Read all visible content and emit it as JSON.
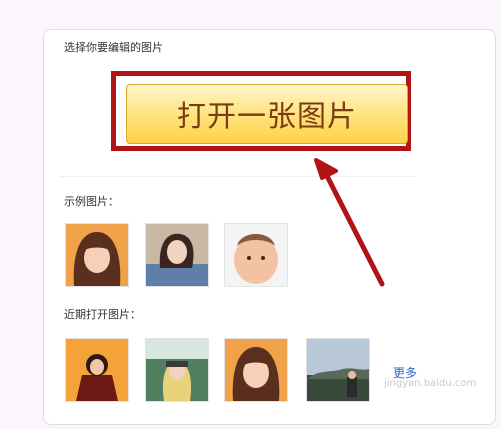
{
  "header": {
    "select_label": "选择你要编辑的图片"
  },
  "open_button": {
    "label": "打开一张图片"
  },
  "samples": {
    "title": "示例图片：",
    "items": [
      {
        "name": "sample-photo-1",
        "alt": ""
      },
      {
        "name": "sample-photo-2",
        "alt": ""
      },
      {
        "name": "sample-photo-3",
        "alt": ""
      }
    ]
  },
  "recent": {
    "title": "近期打开图片：",
    "more_label": "更多",
    "items": [
      {
        "name": "recent-photo-1"
      },
      {
        "name": "recent-photo-2"
      },
      {
        "name": "recent-photo-3"
      },
      {
        "name": "recent-photo-4"
      }
    ]
  },
  "watermark": {
    "text": "jingyan.baidu.com"
  },
  "colors": {
    "highlight_border": "#b11414",
    "button_text": "#7a3c10",
    "button_fill": "#ffe27a",
    "link": "#2f69c8"
  }
}
